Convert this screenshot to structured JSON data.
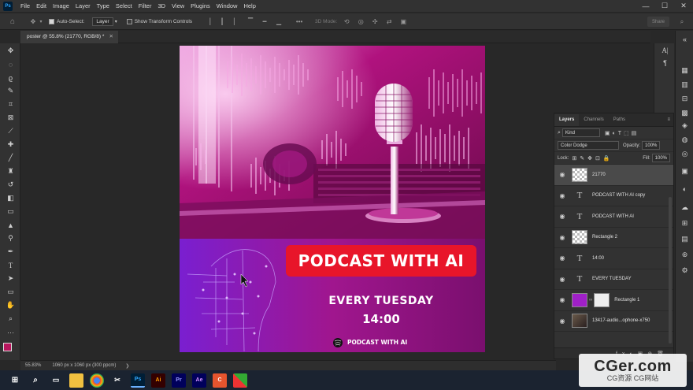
{
  "app": {
    "logo": "Ps"
  },
  "menubar": {
    "items": [
      "File",
      "Edit",
      "Image",
      "Layer",
      "Type",
      "Select",
      "Filter",
      "3D",
      "View",
      "Plugins",
      "Window",
      "Help"
    ]
  },
  "options": {
    "auto_select_label": "Auto-Select:",
    "auto_select_value": "Layer",
    "show_transform_label": "Show Transform Controls",
    "mode_label": "3D Mode:",
    "share_label": "Share"
  },
  "document": {
    "tab_title": "poster @ 55.8% (21770, RGB/8) *"
  },
  "poster": {
    "title": "PODCAST WITH AI",
    "day": "EVERY TUESDAY",
    "time": "14:00",
    "footer_brand": "PODCAST WITH AI",
    "colors": {
      "magenta": "#c5168e",
      "red_badge": "#e8152a",
      "purple": "#6a1aa8"
    }
  },
  "layers_panel": {
    "tabs": [
      "Layers",
      "Channels",
      "Paths"
    ],
    "filter_label": "Kind",
    "blend_mode": "Color Dodge",
    "opacity_label": "Opacity:",
    "opacity_value": "100%",
    "lock_label": "Lock:",
    "fill_label": "Fill:",
    "fill_value": "100%",
    "layers": [
      {
        "name": "21770",
        "type": "smart",
        "selected": true
      },
      {
        "name": "PODCAST WITH AI copy",
        "type": "text",
        "glyph": "T"
      },
      {
        "name": "PODCAST WITH AI",
        "type": "text",
        "glyph": "T"
      },
      {
        "name": "Rectangle 2",
        "type": "image"
      },
      {
        "name": "14:00",
        "type": "text",
        "glyph": "T"
      },
      {
        "name": "EVERY TUESDAY",
        "type": "text",
        "glyph": "T"
      },
      {
        "name": "Rectangle 1",
        "type": "shape"
      },
      {
        "name": "13417-audio...ophone-x750",
        "type": "photo"
      }
    ]
  },
  "statusbar": {
    "zoom": "55.83%",
    "doc_info": "1060 px x 1060 px (300 ppcm)"
  },
  "taskbar": {
    "apps": [
      "Ps",
      "Ai",
      "Pr",
      "Ae"
    ]
  },
  "watermark": {
    "main": "CGer.com",
    "sub": "CG资源 CG网站"
  }
}
